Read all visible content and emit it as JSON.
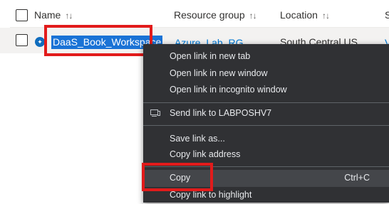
{
  "grid": {
    "columns": [
      {
        "key": "name",
        "label": "Name",
        "sort_icon": "sort-arrows-icon"
      },
      {
        "key": "resource_group",
        "label": "Resource group",
        "sort_icon": "sort-arrows-icon"
      },
      {
        "key": "location",
        "label": "Location",
        "sort_icon": "sort-arrows-icon"
      },
      {
        "key": "next",
        "label": "S"
      }
    ],
    "sort_glyph": "↑↓",
    "rows": [
      {
        "icon": "workspace-icon",
        "name": "DaaS_Book_Workspace",
        "resource_group": "Azure_Lab_RG",
        "location": "South Central US",
        "next_col": "V"
      }
    ]
  },
  "context_menu": {
    "items": [
      {
        "label": "Open link in new tab"
      },
      {
        "label": "Open link in new window"
      },
      {
        "label": "Open link in incognito window"
      },
      {
        "label": "Send link to LABPOSHV7",
        "icon": "device-icon"
      },
      {
        "label": "Save link as..."
      },
      {
        "label": "Copy link address"
      },
      {
        "label": "Copy",
        "shortcut": "Ctrl+C",
        "highlighted": true
      },
      {
        "label": "Copy link to highlight"
      }
    ]
  },
  "colors": {
    "annotation_red": "#e21b1b",
    "selection_blue": "#1a73d6",
    "menu_bg": "#303134",
    "menu_highlight": "#44464a",
    "link_blue": "#0078d4"
  }
}
